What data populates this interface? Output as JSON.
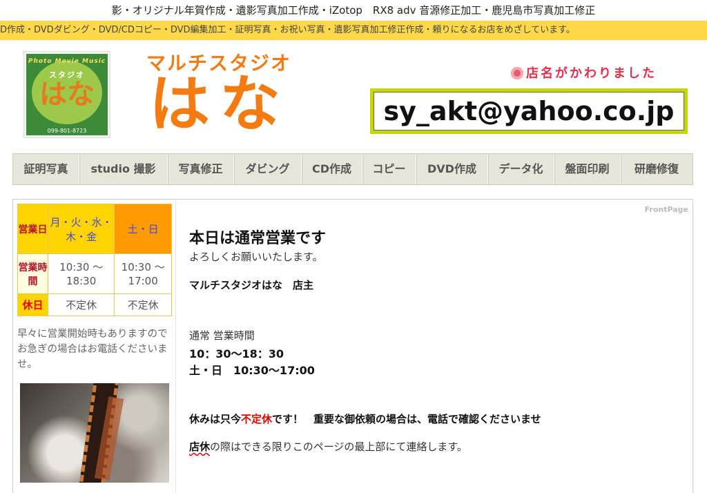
{
  "top_banner": "影・オリジナル年賀作成・遺影写真加工作成・iZotop　RX8 adv 音源修正加工・鹿児島市写真加工修正",
  "ticker": "D作成・DVDダビング・DVD/CDコピー・DVD編集加工・証明写真・お祝い写真・遺影写真加工修正作成・頼りになるお店をめざしています。",
  "logo": {
    "arc_text": "Photo Movie Music",
    "studio": "スタジオ",
    "name": "はな",
    "phone": "099-801-8723"
  },
  "brand": {
    "subtitle": "マルチスタジオ",
    "name": "はな"
  },
  "notice": "店名がかわりました",
  "email": "sy_akt@yahoo.co.jp",
  "nav": [
    {
      "label": "証明写真",
      "w": 96
    },
    {
      "label": "studio 撮影",
      "w": 128
    },
    {
      "label": "写真修正",
      "w": 96
    },
    {
      "label": "ダビング",
      "w": 98
    },
    {
      "label": "CD作成",
      "w": 88
    },
    {
      "label": "コピー",
      "w": 78
    },
    {
      "label": "DVD作成",
      "w": 104
    },
    {
      "label": "データ化",
      "w": 96
    },
    {
      "label": "盤面印刷",
      "w": 96
    },
    {
      "label": "研磨修復",
      "w": 104
    }
  ],
  "hours": {
    "label_days": "営業日",
    "weekdays": "月・火・水・木・金",
    "weekend": "土・日",
    "label_hours": "営業時間",
    "weekday_hours": "10:30 〜 18:30",
    "weekend_hours": "10:30 〜 17:00",
    "label_closed": "休日",
    "closed_weekday": "不定休",
    "closed_weekend": "不定休"
  },
  "side_note": "早々に営業開始時もありますのでお急ぎの場合はお電話くださいませ。",
  "main": {
    "page_tag": "FrontPage",
    "title": "本日は通常営業です",
    "greeting": "よろしくお願いいたします。",
    "signature": "マルチスタジオはな　店主",
    "hours_heading": "通常 営業時間",
    "hours_weekday": "10：30〜18：30",
    "hours_weekend": "土・日　10:30〜17:00",
    "holiday_pre": "休みは只今",
    "holiday_red": "不定休",
    "holiday_post": "です！　重要な御依頼の場合は、電話で確認くださいませ",
    "closure_word": "店休",
    "closure_rest": "の際はできる限りこのページの最上部にて連絡します。"
  }
}
